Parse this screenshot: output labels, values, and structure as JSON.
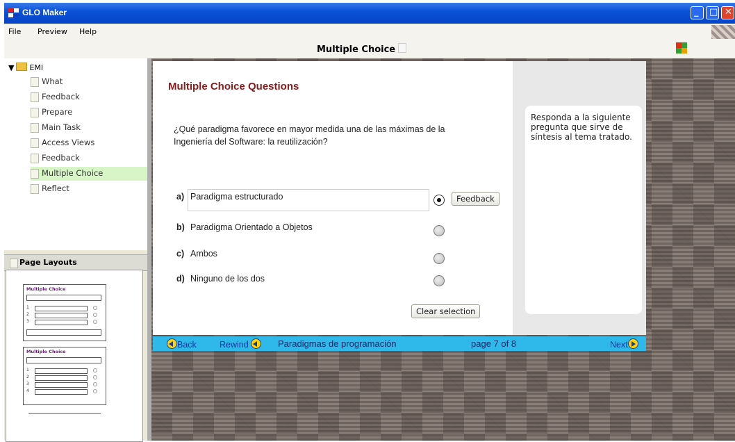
{
  "window": {
    "title": "GLO Maker"
  },
  "menu": [
    "File",
    "Preview",
    "Help"
  ],
  "toolbar": {
    "page_title": "Multiple Choice"
  },
  "tree": {
    "root": "EMI",
    "items": [
      "What",
      "Feedback",
      "Prepare",
      "Main Task",
      "Access Views",
      "Feedback",
      "Multiple Choice",
      "Reflect"
    ],
    "selected": "Multiple Choice"
  },
  "page_layouts": {
    "header": "Page Layouts",
    "thumbs": [
      {
        "title": "Multiple Choice",
        "rows": [
          "1",
          "2",
          "3"
        ]
      },
      {
        "title": "Multiple Choice",
        "rows": [
          "1",
          "2",
          "3",
          "4"
        ]
      }
    ]
  },
  "question": {
    "heading": "Multiple Choice Questions",
    "text": "¿Qué paradigma favorece en mayor medida una de las máximas de la Ingeniería del Software: la reutilización?",
    "options": [
      {
        "letter": "a)",
        "text": "Paradigma estructurado",
        "selected": true
      },
      {
        "letter": "b)",
        "text": "Paradigma Orientado a Objetos",
        "selected": false
      },
      {
        "letter": "c)",
        "text": "Ambos",
        "selected": false
      },
      {
        "letter": "d)",
        "text": "Ninguno de los dos",
        "selected": false
      }
    ],
    "feedback_label": "Feedback",
    "clear_label": "Clear selection"
  },
  "side_note": "Responda a la siguiente pregunta que sirve de síntesis al tema tratado.",
  "navbar": {
    "back": "Back",
    "rewind": "Rewind",
    "title": "Paradigmas de programación",
    "page": "page 7 of 8",
    "next": "Next"
  },
  "colors": {
    "titlebar": "#0a52d8",
    "heading": "#8b1a1a",
    "navbar": "#2eb9ea",
    "selected_item": "#d8f5c8"
  }
}
